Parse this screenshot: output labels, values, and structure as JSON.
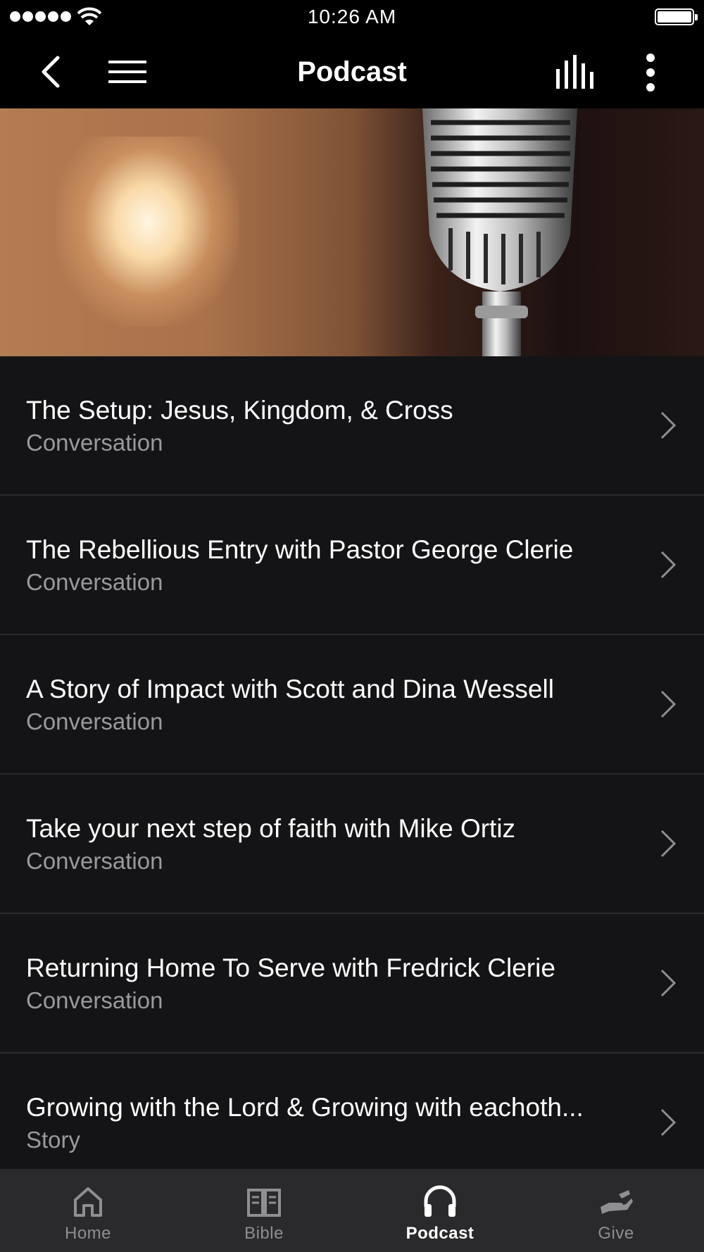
{
  "status_bar": {
    "time": "10:26 AM"
  },
  "header": {
    "title": "Podcast"
  },
  "episodes": [
    {
      "title": "The Setup: Jesus, Kingdom, & Cross",
      "subtitle": "Conversation"
    },
    {
      "title": "The Rebellious Entry with Pastor George Clerie",
      "subtitle": "Conversation"
    },
    {
      "title": "A Story of Impact with Scott and Dina Wessell",
      "subtitle": "Conversation"
    },
    {
      "title": "Take your next step of faith with Mike Ortiz",
      "subtitle": "Conversation"
    },
    {
      "title": "Returning Home To Serve with Fredrick Clerie",
      "subtitle": "Conversation"
    },
    {
      "title": "Growing with the Lord & Growing with eachoth...",
      "subtitle": "Story"
    }
  ],
  "tabs": [
    {
      "label": "Home",
      "icon": "home-icon"
    },
    {
      "label": "Bible",
      "icon": "book-icon"
    },
    {
      "label": "Podcast",
      "icon": "headphones-icon"
    },
    {
      "label": "Give",
      "icon": "giving-hand-icon"
    }
  ],
  "active_tab": "Podcast",
  "colors": {
    "background": "#000000",
    "list_bg": "#141416",
    "tab_bar_bg": "#2a2a2c",
    "subtitle": "#9a9a9c",
    "inactive_tab": "#8e8e93"
  }
}
